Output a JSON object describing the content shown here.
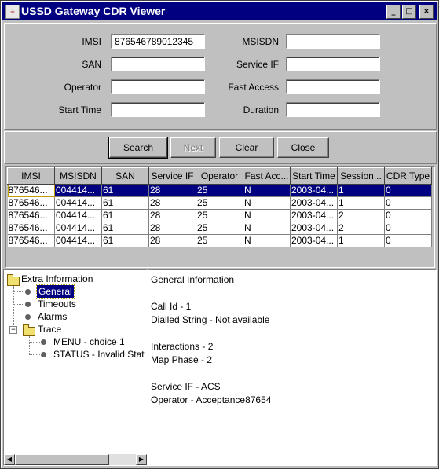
{
  "window": {
    "title": "USSD Gateway CDR Viewer",
    "minimize": "_",
    "maximize": "□",
    "close": "×"
  },
  "form": {
    "imsi_label": "IMSI",
    "imsi_value": "876546789012345",
    "msisdn_label": "MSISDN",
    "msisdn_value": "",
    "san_label": "SAN",
    "san_value": "",
    "service_if_label": "Service IF",
    "service_if_value": "",
    "operator_label": "Operator",
    "operator_value": "",
    "fast_access_label": "Fast Access",
    "fast_access_value": "",
    "start_time_label": "Start Time",
    "start_time_value": "",
    "duration_label": "Duration",
    "duration_value": ""
  },
  "buttons": {
    "search": "Search",
    "next": "Next",
    "clear": "Clear",
    "close": "Close"
  },
  "table": {
    "columns": [
      "IMSI",
      "MSISDN",
      "SAN",
      "Service IF",
      "Operator",
      "Fast Acc...",
      "Start Time",
      "Session...",
      "CDR Type"
    ],
    "rows": [
      [
        "876546...",
        "004414...",
        "61",
        "28",
        "25",
        "N",
        "2003-04...",
        "1",
        "0"
      ],
      [
        "876546...",
        "004414...",
        "61",
        "28",
        "25",
        "N",
        "2003-04...",
        "1",
        "0"
      ],
      [
        "876546...",
        "004414...",
        "61",
        "28",
        "25",
        "N",
        "2003-04...",
        "2",
        "0"
      ],
      [
        "876546...",
        "004414...",
        "61",
        "28",
        "25",
        "N",
        "2003-04...",
        "2",
        "0"
      ],
      [
        "876546...",
        "004414...",
        "61",
        "28",
        "25",
        "N",
        "2003-04...",
        "1",
        "0"
      ]
    ]
  },
  "tree": {
    "root": "Extra Information",
    "general": "General",
    "timeouts": "Timeouts",
    "alarms": "Alarms",
    "trace": "Trace",
    "trace_item_1": "MENU - choice 1",
    "trace_item_2": "STATUS - Invalid Stat"
  },
  "info": {
    "heading": "General Information",
    "call_id": "Call Id  -  1",
    "dialled": "Dialled String  -  Not available",
    "interactions": "Interactions  -  2",
    "map_phase": "Map Phase  -  2",
    "service_if": "Service IF  -  ACS",
    "operator": "Operator  -  Acceptance87654"
  },
  "colors": {
    "titlebar": "#000080",
    "selection": "#000080",
    "face": "#c0c0c0"
  }
}
